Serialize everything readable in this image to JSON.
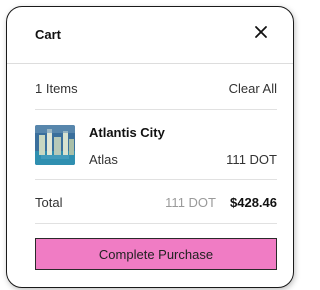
{
  "cart": {
    "title": "Cart",
    "close_icon": "close-icon",
    "item_count_label": "1 Items",
    "clear_all_label": "Clear All",
    "items": [
      {
        "name": "Atlantis City",
        "collection": "Atlas",
        "price": "111 DOT",
        "thumbnail_icon": "nft-thumbnail"
      }
    ],
    "total": {
      "label": "Total",
      "crypto": "111 DOT",
      "fiat": "$428.46"
    },
    "purchase_button_label": "Complete Purchase",
    "colors": {
      "button_bg": "#f07cc4",
      "border": "#1a1a1a",
      "muted_text": "#9a9a9a"
    }
  }
}
